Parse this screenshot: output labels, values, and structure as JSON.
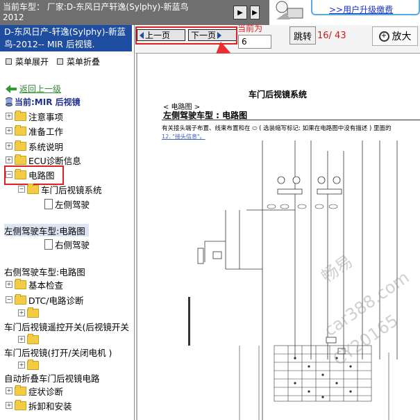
{
  "header": {
    "car_label": "当前车型： 厂家:D-东风日产轩逸(Sylphy)-新蓝鸟2012",
    "promo_link": ">>用户升级缴费"
  },
  "sidebar": {
    "title": "D-东风日产-轩逸(Sylphy)-新蓝鸟-2012-- MIR 后视镜.",
    "expand_label": "菜单展开",
    "collapse_label": "菜单折叠",
    "back_label": "返回上一级",
    "current_label": "当前:MIR 后视镜",
    "items": [
      {
        "label": "注意事项"
      },
      {
        "label": "准备工作"
      },
      {
        "label": "系统说明"
      },
      {
        "label": "ECU诊断信息"
      },
      {
        "label": "电路图"
      },
      {
        "label": "车门后视镜系统"
      },
      {
        "label": "左侧驾驶"
      },
      {
        "label": "左侧驾驶车型:电路图"
      },
      {
        "label": "右侧驾驶"
      },
      {
        "label": "右侧驾驶车型:电路图"
      },
      {
        "label": "基本检查"
      },
      {
        "label": "DTC/电路诊断"
      },
      {
        "label": "车门后视镜遥控开关(后视镜开关"
      },
      {
        "label": "车门后视镜(打开/关闭电机 )"
      },
      {
        "label": "自动折叠车门后视镜电路"
      },
      {
        "label": "症状诊断"
      },
      {
        "label": "拆卸和安装"
      }
    ]
  },
  "nav": {
    "prev_label": "上一页",
    "next_label": "下一页",
    "current_page_label": "当前为",
    "page_value": "6",
    "goto_label": "跳转",
    "page_count": "16/ 43",
    "zoom_label": "放大"
  },
  "document": {
    "heading": "车门后视镜系统",
    "section_label": "< 电路图 >",
    "section_title": "左侧驾驶车型 : 电路图",
    "notice": "有关接头端子布置、线束布置和在 ⬭ ( 选装缩写标记: 如果在电路图中没有描述 ) 里面的",
    "notice_link": "12. \"接头信息\"。"
  },
  "watermark": {
    "line1": "畅易",
    "line2": "car388.com",
    "line3": "CY20165"
  }
}
